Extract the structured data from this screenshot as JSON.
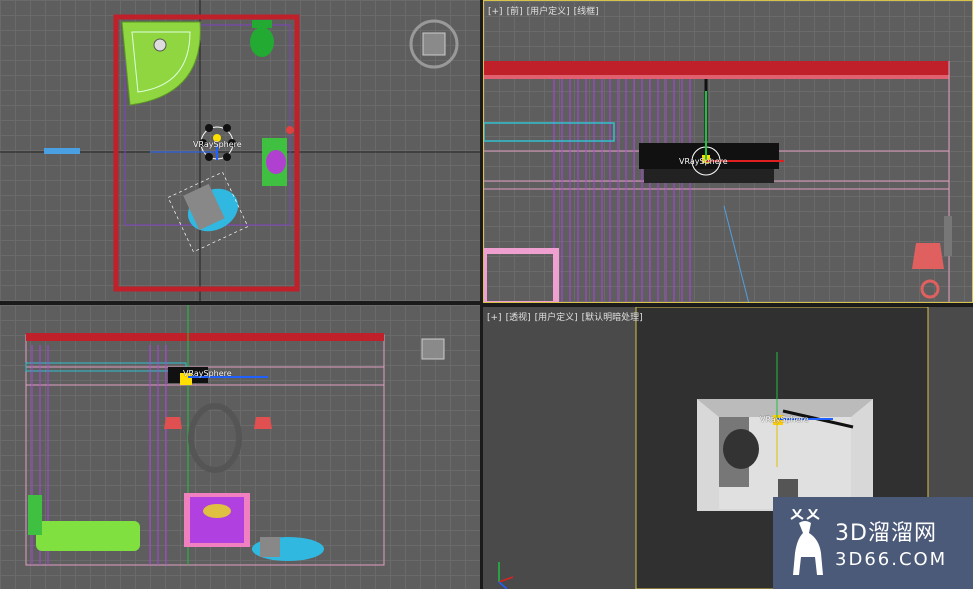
{
  "viewports": {
    "top_right": {
      "labels": [
        "[+]",
        "[前]",
        "[用户定义]",
        "[线框]"
      ]
    },
    "bottom_right": {
      "labels": [
        "[+]",
        "[透视]",
        "[用户定义]",
        "[默认明暗处理]"
      ]
    }
  },
  "objects": {
    "vraysphere_label": "VRaySphere"
  },
  "watermark": {
    "brand_cn": "3D溜溜网",
    "brand_url": "3D66.COM"
  },
  "colors": {
    "viewport_bg": "#5e5e5e",
    "active_border": "#d8c24a",
    "wall_red": "#c0202a",
    "magenta": "#c040e0",
    "green": "#40c040"
  }
}
